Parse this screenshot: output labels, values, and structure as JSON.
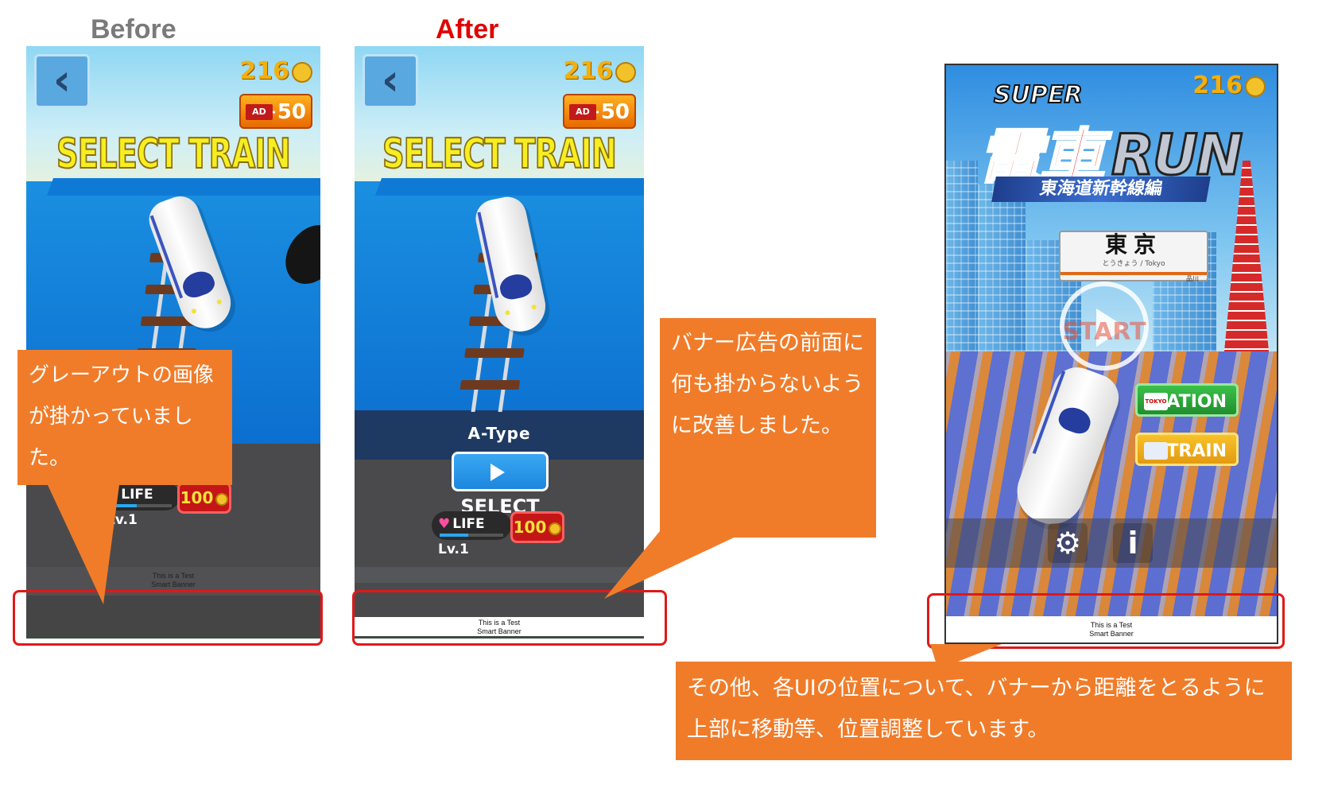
{
  "labels": {
    "before": "Before",
    "after": "After"
  },
  "game": {
    "coins": "216",
    "ad_bonus": "+50",
    "ad_badge": "AD",
    "select_title": "SELECT TRAIN",
    "train_type": "A-Type",
    "select_button": "SELECT",
    "life_label": "LIFE Lv.1",
    "life_price": "100",
    "life_level_fraction": 0.45,
    "back_glyph": "‹"
  },
  "banner": {
    "line1": "This is a Test",
    "line2": "Smart Banner"
  },
  "title_screen": {
    "coins": "216",
    "logo_super": "SUPER",
    "logo_main": "電車",
    "logo_run": "RUN",
    "logo_subtitle": "東海道新幹線編",
    "station_name": "東京",
    "station_kana": "とうきょう / Tokyo",
    "station_next": "品川",
    "start_label": "START",
    "station_button": "STATION",
    "station_badge": "TOKYO",
    "train_button": "TRAIN",
    "settings_icon": "gear-icon",
    "info_icon": "info-icon",
    "info_glyph": "i",
    "settings_glyph": "⚙"
  },
  "callouts": {
    "before_note": "グレーアウトの画像が掛かっていました。",
    "after_note": "バナー広告の前面に何も掛からないように改善しました。",
    "title_note": "その他、各UIの位置について、バナーから距離をとるように上部に移動等、位置調整しています。"
  },
  "colors": {
    "callout": "#f07c2a",
    "highlight": "#e01818",
    "after_label": "#e00000",
    "before_label": "#7a7a7a"
  }
}
